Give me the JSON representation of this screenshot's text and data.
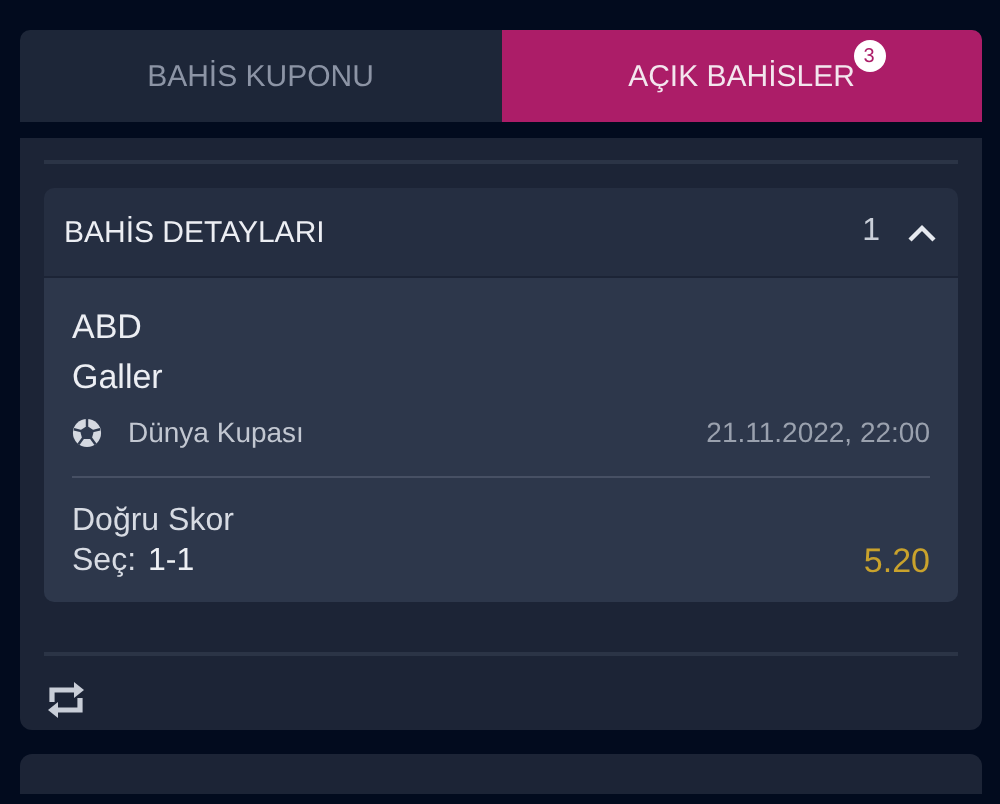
{
  "tabs": [
    {
      "label": "BAHİS KUPONU",
      "selected": false
    },
    {
      "label": "AÇIK BAHİSLER",
      "selected": true,
      "badge": "3"
    }
  ],
  "bet_details": {
    "title": "BAHİS DETAYLARI",
    "count": "1",
    "expanded": true,
    "event": {
      "home": "ABD",
      "away": "Galler",
      "competition": "Dünya Kupası",
      "datetime": "21.11.2022, 22:00"
    },
    "market": "Doğru Skor",
    "selection_label": "Seç:",
    "selection": "1-1",
    "odds": "5.20"
  }
}
